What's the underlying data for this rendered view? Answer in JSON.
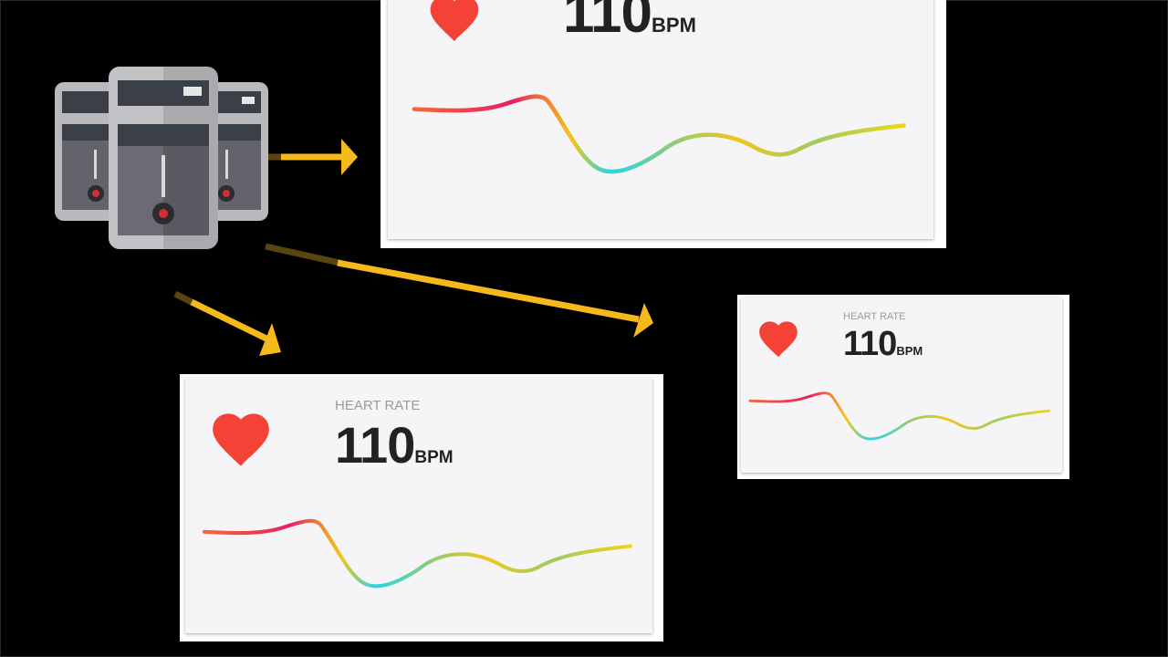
{
  "colors": {
    "background": "#000000",
    "card": "#f5f5f7",
    "heart": "#f44336",
    "arrow": "#f6b91c",
    "gradient": [
      "#f26a3a",
      "#e91e63",
      "#f5c518",
      "#26d6e6",
      "#9ccc65",
      "#f5d316"
    ]
  },
  "source": {
    "icon": "server-icon"
  },
  "cards": [
    {
      "icon": "heart-icon",
      "label": "",
      "value": "110",
      "unit": "BPM"
    },
    {
      "icon": "heart-icon",
      "label": "HEART RATE",
      "value": "110",
      "unit": "BPM"
    },
    {
      "icon": "heart-icon",
      "label": "HEART RATE",
      "value": "110",
      "unit": "BPM"
    }
  ]
}
